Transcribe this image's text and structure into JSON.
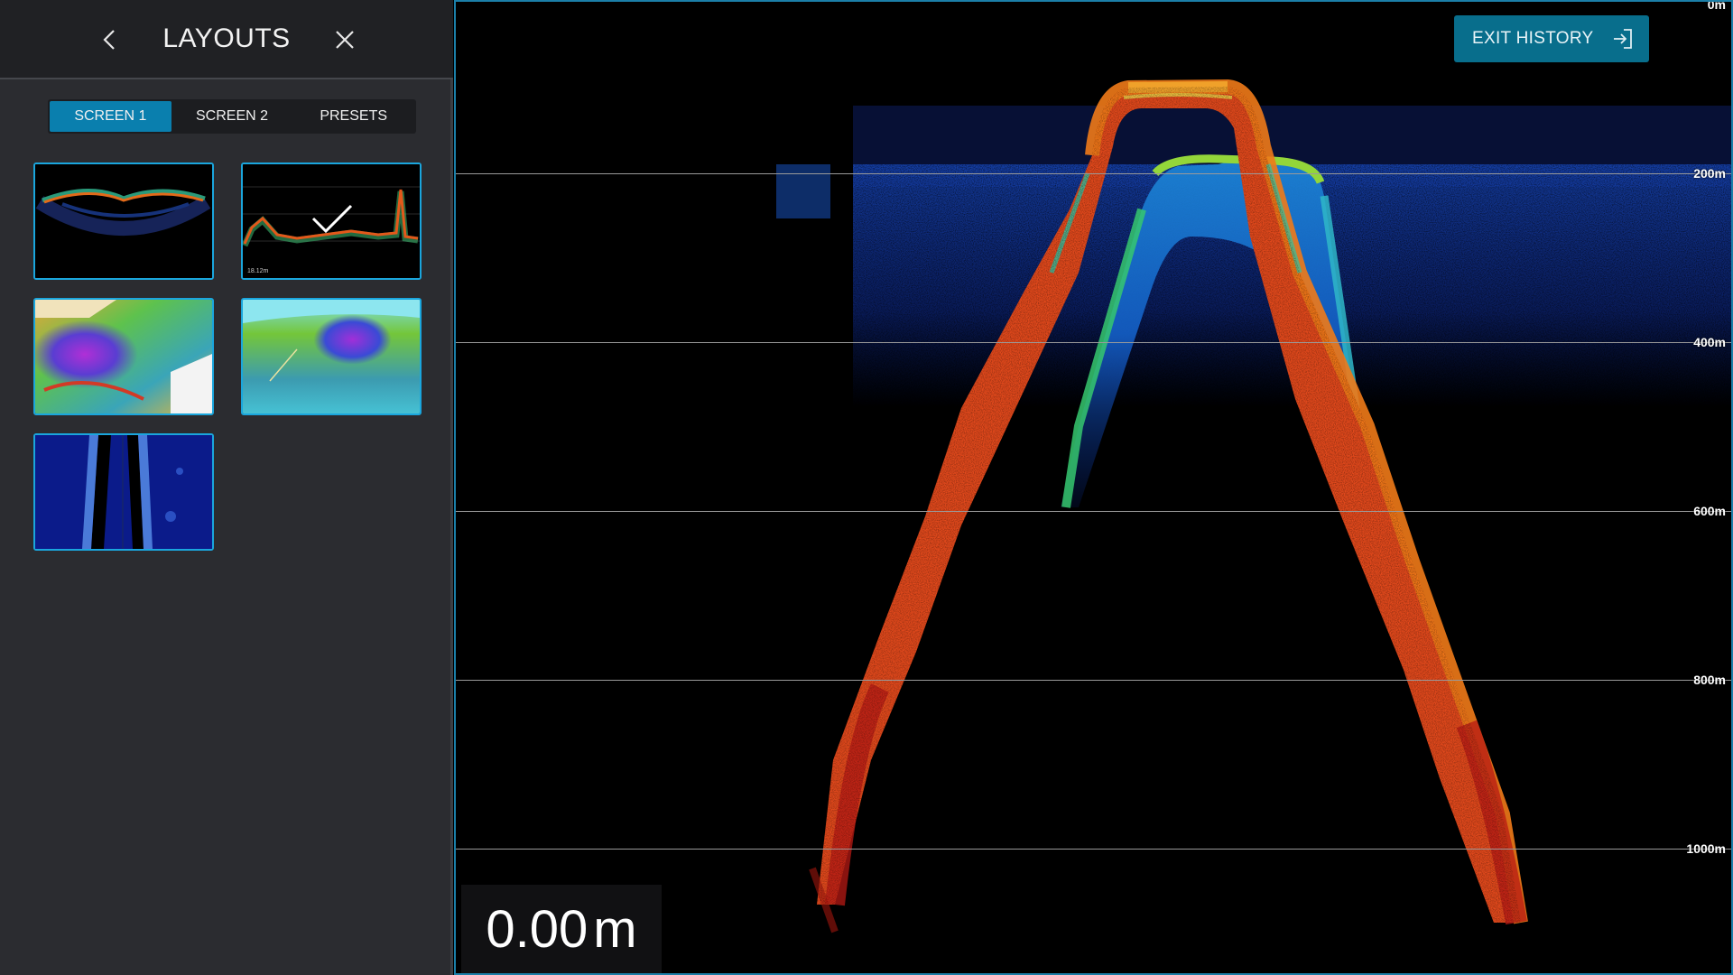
{
  "panel": {
    "title": "LAYOUTS",
    "tabs": [
      {
        "label": "SCREEN 1",
        "active": true
      },
      {
        "label": "SCREEN 2",
        "active": false
      },
      {
        "label": "PRESETS",
        "active": false
      }
    ],
    "thumbnails": [
      {
        "name": "sonar-arc-layout"
      },
      {
        "name": "echogram-layout",
        "selected": true,
        "caption": "18.12m"
      },
      {
        "name": "bathymetry-2d-layout"
      },
      {
        "name": "bathymetry-3d-layout"
      },
      {
        "name": "sidescan-layout"
      }
    ]
  },
  "view": {
    "exit_label": "EXIT HISTORY",
    "depth_scale": [
      {
        "label": "0m"
      },
      {
        "label": "200m"
      },
      {
        "label": "400m"
      },
      {
        "label": "600m"
      },
      {
        "label": "800m"
      },
      {
        "label": "1000m"
      }
    ],
    "readout": {
      "value": "0.00",
      "unit": "m"
    }
  },
  "colors": {
    "accent": "#0a7fae",
    "panel_bg": "#2b2c30",
    "thumb_border": "#1aa6dd",
    "exit_button": "#086e8c"
  },
  "icons": {
    "back": "chevron-left-icon",
    "close": "close-icon",
    "exit": "exit-arrow-icon",
    "selected": "checkmark-icon"
  }
}
